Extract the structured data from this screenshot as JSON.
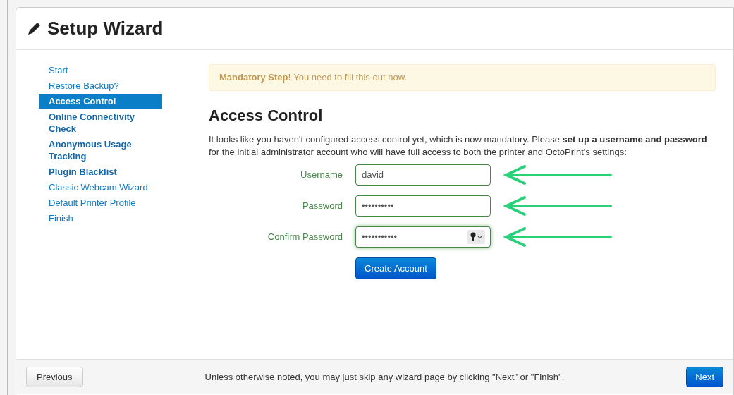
{
  "window": {
    "title": "Setup Wizard"
  },
  "sidebar": {
    "items": [
      {
        "label": "Start",
        "selected": false,
        "required": false
      },
      {
        "label": "Restore Backup?",
        "selected": false,
        "required": false
      },
      {
        "label": "Access Control",
        "selected": true,
        "required": true
      },
      {
        "label": "Online Connectivity Check",
        "selected": false,
        "required": true
      },
      {
        "label": "Anonymous Usage Tracking",
        "selected": false,
        "required": true
      },
      {
        "label": "Plugin Blacklist",
        "selected": false,
        "required": true
      },
      {
        "label": "Classic Webcam Wizard",
        "selected": false,
        "required": false
      },
      {
        "label": "Default Printer Profile",
        "selected": false,
        "required": false
      },
      {
        "label": "Finish",
        "selected": false,
        "required": false
      }
    ]
  },
  "alert": {
    "text": "**Mandatory Step!** You need to fill this out now."
  },
  "heading": "Access Control",
  "description": "It looks like you haven't configured access control yet, which is now mandatory. Please **set up a username and password** for the initial administrator account who will have full access to both the printer and OctoPrint's settings:",
  "form": {
    "fields": [
      {
        "label": "Username",
        "value": "david",
        "focused": false
      },
      {
        "label": "Password",
        "value": "••••••••••",
        "focused": false
      },
      {
        "label": "Confirm Password",
        "value": "•••••••••••",
        "focused": true
      }
    ],
    "submit": "Create Account"
  },
  "footer": {
    "previous": "Previous",
    "note": "Unless otherwise noted, you may just skip any wizard page by clicking \"Next\" or \"Finish\".",
    "next": "Next"
  }
}
